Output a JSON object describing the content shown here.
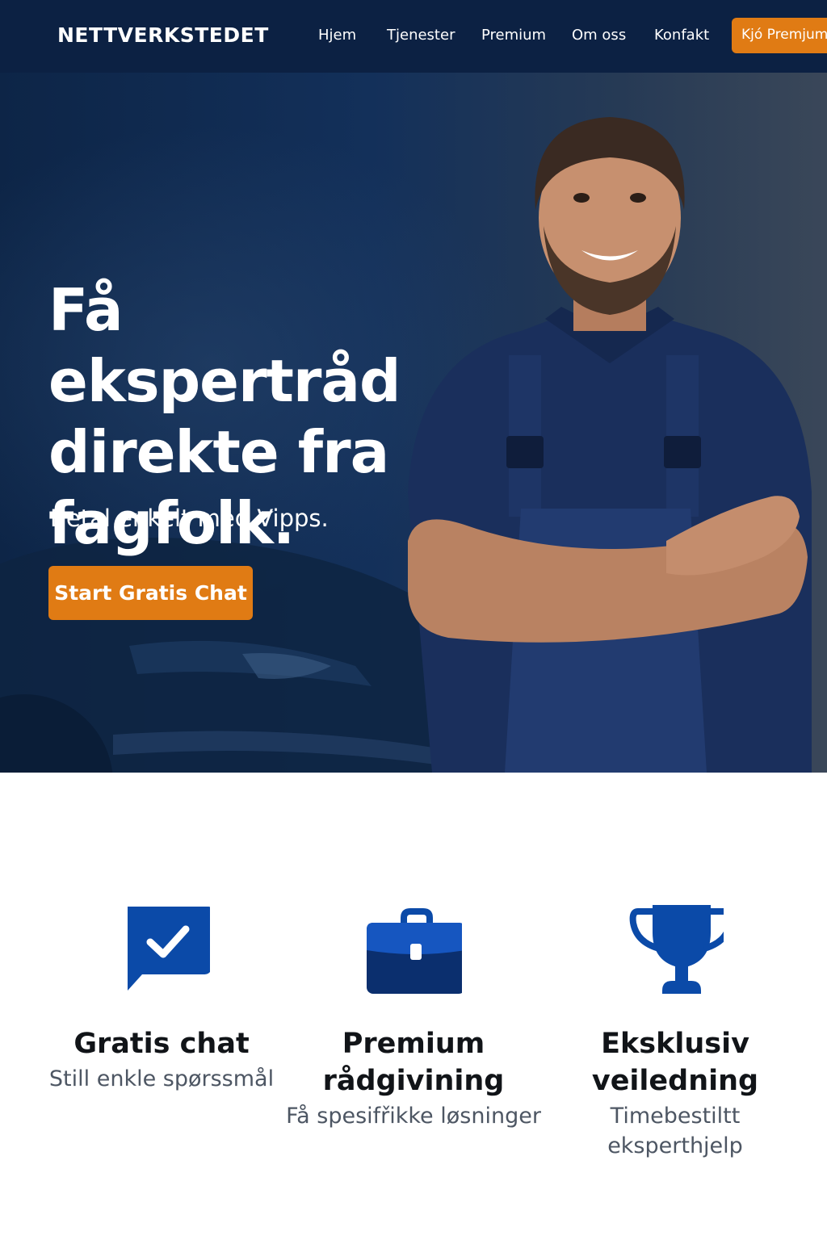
{
  "nav": {
    "brand": "NETTVERKSTEDET",
    "links": [
      "Hjem",
      "Tjenester",
      "Premium",
      "Om oss",
      "Konfakt"
    ],
    "cta": "Kjó Premjum"
  },
  "hero": {
    "title": "Få ekspertråd direkte fra fagfolk.",
    "subtitle": "Betal enkelt med Vipps.",
    "cta": "Start Gratis Chat"
  },
  "features": [
    {
      "icon": "chat-check-icon",
      "title": "Gratis chat",
      "description": "Still enkle spørssmål"
    },
    {
      "icon": "briefcase-icon",
      "title": "Premium rådgivining",
      "description": "Få spesifřikke løsninger"
    },
    {
      "icon": "trophy-icon",
      "title": "Eksklusiv veiledning",
      "description": "Timebestiltt eksperthjelp"
    }
  ],
  "colors": {
    "nav_bg": "#0c2143",
    "accent": "#e07b14",
    "icon_blue": "#0b4aa8",
    "hero_bg": "#13305a"
  }
}
